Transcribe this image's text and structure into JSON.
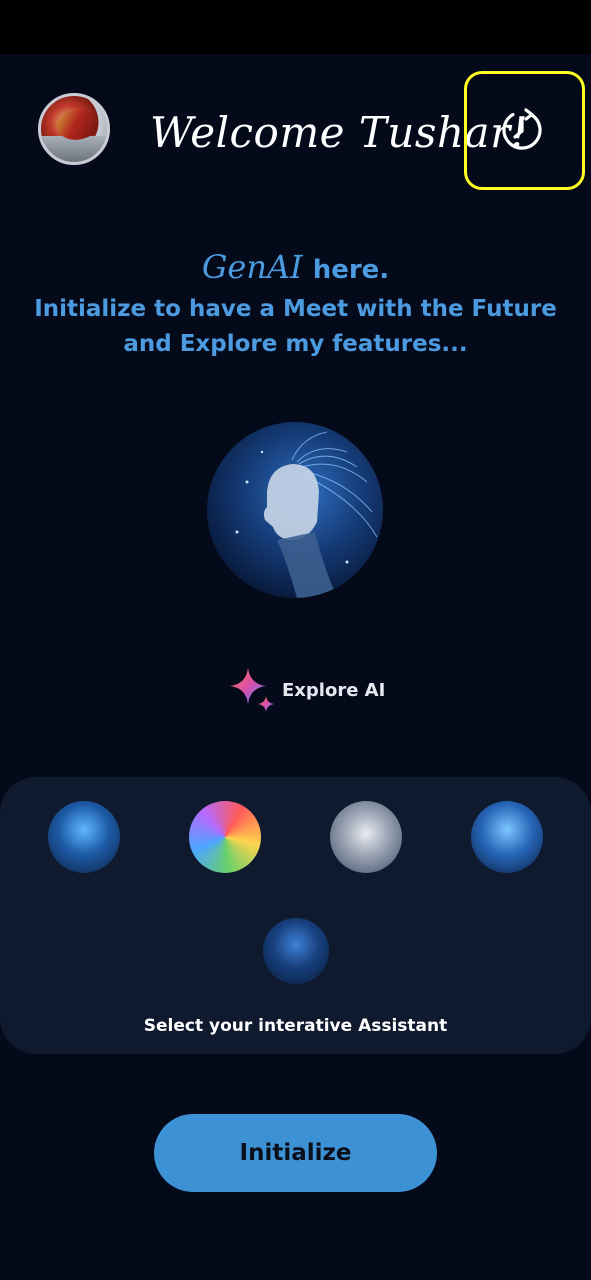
{
  "header": {
    "welcome_title": "Welcome Tushar!",
    "history_icon": "history-clock-icon",
    "highlight_color": "#ffff24"
  },
  "intro": {
    "brand": "GenAI",
    "brand_suffix": "here.",
    "line2": "Initialize to have a Meet with the Future",
    "line3": "and Explore my features...",
    "text_color": "#4c9be0"
  },
  "explore": {
    "label": "Explore AI",
    "icon": "sparkle-icon"
  },
  "assistants": {
    "caption": "Select your interative Assistant",
    "options": [
      "assistant-1",
      "assistant-2",
      "assistant-3",
      "assistant-4"
    ]
  },
  "actions": {
    "initialize_label": "Initialize",
    "button_color": "#3d92d6"
  },
  "colors": {
    "background": "#050a1b",
    "panel": "#101a2f"
  }
}
